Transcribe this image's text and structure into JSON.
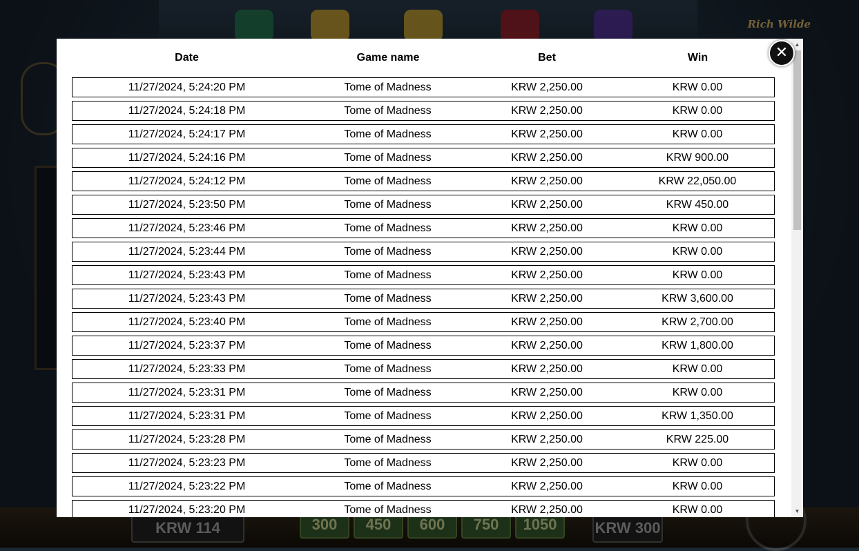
{
  "background": {
    "logo_text": "Rich Wilde",
    "balance": "KRW 114",
    "bet_chips": [
      "300",
      "450",
      "600",
      "750",
      "1050"
    ],
    "bet_amount": "KRW 300"
  },
  "history": {
    "columns": [
      "Date",
      "Game name",
      "Bet",
      "Win"
    ],
    "rows": [
      {
        "date": "11/27/2024, 5:24:20 PM",
        "game": "Tome of Madness",
        "bet": "KRW 2,250.00",
        "win": "KRW 0.00"
      },
      {
        "date": "11/27/2024, 5:24:18 PM",
        "game": "Tome of Madness",
        "bet": "KRW 2,250.00",
        "win": "KRW 0.00"
      },
      {
        "date": "11/27/2024, 5:24:17 PM",
        "game": "Tome of Madness",
        "bet": "KRW 2,250.00",
        "win": "KRW 0.00"
      },
      {
        "date": "11/27/2024, 5:24:16 PM",
        "game": "Tome of Madness",
        "bet": "KRW 2,250.00",
        "win": "KRW 900.00"
      },
      {
        "date": "11/27/2024, 5:24:12 PM",
        "game": "Tome of Madness",
        "bet": "KRW 2,250.00",
        "win": "KRW 22,050.00"
      },
      {
        "date": "11/27/2024, 5:23:50 PM",
        "game": "Tome of Madness",
        "bet": "KRW 2,250.00",
        "win": "KRW 450.00"
      },
      {
        "date": "11/27/2024, 5:23:46 PM",
        "game": "Tome of Madness",
        "bet": "KRW 2,250.00",
        "win": "KRW 0.00"
      },
      {
        "date": "11/27/2024, 5:23:44 PM",
        "game": "Tome of Madness",
        "bet": "KRW 2,250.00",
        "win": "KRW 0.00"
      },
      {
        "date": "11/27/2024, 5:23:43 PM",
        "game": "Tome of Madness",
        "bet": "KRW 2,250.00",
        "win": "KRW 0.00"
      },
      {
        "date": "11/27/2024, 5:23:43 PM",
        "game": "Tome of Madness",
        "bet": "KRW 2,250.00",
        "win": "KRW 3,600.00"
      },
      {
        "date": "11/27/2024, 5:23:40 PM",
        "game": "Tome of Madness",
        "bet": "KRW 2,250.00",
        "win": "KRW 2,700.00"
      },
      {
        "date": "11/27/2024, 5:23:37 PM",
        "game": "Tome of Madness",
        "bet": "KRW 2,250.00",
        "win": "KRW 1,800.00"
      },
      {
        "date": "11/27/2024, 5:23:33 PM",
        "game": "Tome of Madness",
        "bet": "KRW 2,250.00",
        "win": "KRW 0.00"
      },
      {
        "date": "11/27/2024, 5:23:31 PM",
        "game": "Tome of Madness",
        "bet": "KRW 2,250.00",
        "win": "KRW 0.00"
      },
      {
        "date": "11/27/2024, 5:23:31 PM",
        "game": "Tome of Madness",
        "bet": "KRW 2,250.00",
        "win": "KRW 1,350.00"
      },
      {
        "date": "11/27/2024, 5:23:28 PM",
        "game": "Tome of Madness",
        "bet": "KRW 2,250.00",
        "win": "KRW 225.00"
      },
      {
        "date": "11/27/2024, 5:23:23 PM",
        "game": "Tome of Madness",
        "bet": "KRW 2,250.00",
        "win": "KRW 0.00"
      },
      {
        "date": "11/27/2024, 5:23:22 PM",
        "game": "Tome of Madness",
        "bet": "KRW 2,250.00",
        "win": "KRW 0.00"
      },
      {
        "date": "11/27/2024, 5:23:20 PM",
        "game": "Tome of Madness",
        "bet": "KRW 2,250.00",
        "win": "KRW 0.00"
      }
    ]
  },
  "close_button": {
    "icon": "close-icon",
    "glyph": "✕"
  },
  "scrollbar": {
    "up_glyph": "▲",
    "down_glyph": "▼",
    "scroll_fraction": 0.0
  }
}
